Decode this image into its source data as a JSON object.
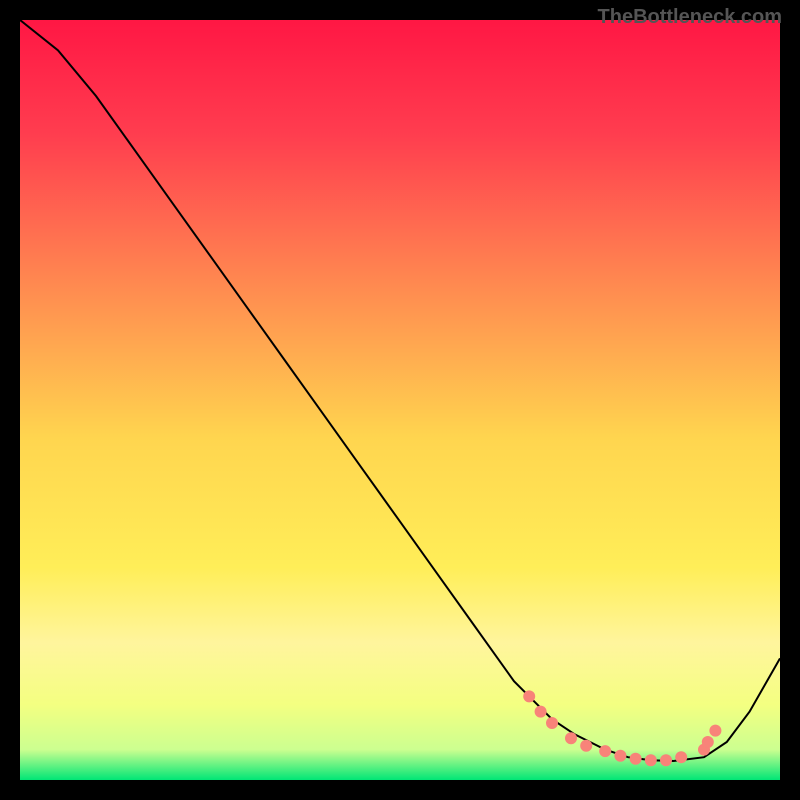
{
  "watermark": "TheBottleneck.com",
  "chart_data": {
    "type": "line",
    "title": "",
    "xlabel": "",
    "ylabel": "",
    "xlim": [
      0,
      100
    ],
    "ylim": [
      0,
      100
    ],
    "background_gradient": {
      "type": "vertical",
      "stops": [
        {
          "pos": 0.0,
          "color": "#ff1744"
        },
        {
          "pos": 0.15,
          "color": "#ff3d4f"
        },
        {
          "pos": 0.35,
          "color": "#ff8a50"
        },
        {
          "pos": 0.55,
          "color": "#ffd54f"
        },
        {
          "pos": 0.72,
          "color": "#ffee58"
        },
        {
          "pos": 0.82,
          "color": "#fff59d"
        },
        {
          "pos": 0.9,
          "color": "#f4ff81"
        },
        {
          "pos": 0.96,
          "color": "#ccff90"
        },
        {
          "pos": 1.0,
          "color": "#00e676"
        }
      ]
    },
    "series": [
      {
        "name": "main-curve",
        "color": "#000000",
        "stroke_width": 2,
        "x": [
          0,
          5,
          10,
          15,
          20,
          25,
          30,
          35,
          40,
          45,
          50,
          55,
          60,
          65,
          67,
          70,
          73,
          77,
          80,
          83,
          86,
          90,
          93,
          96,
          100
        ],
        "values": [
          100,
          96,
          90,
          83,
          76,
          69,
          62,
          55,
          48,
          41,
          34,
          27,
          20,
          13,
          11,
          8,
          6,
          4,
          3,
          2.6,
          2.5,
          3,
          5,
          9,
          16
        ]
      }
    ],
    "markers": {
      "name": "bottom-dots",
      "color": "#f88379",
      "radius": 6,
      "points": [
        {
          "x": 67,
          "y": 11
        },
        {
          "x": 68.5,
          "y": 9
        },
        {
          "x": 70,
          "y": 7.5
        },
        {
          "x": 72.5,
          "y": 5.5
        },
        {
          "x": 74.5,
          "y": 4.5
        },
        {
          "x": 77,
          "y": 3.8
        },
        {
          "x": 79,
          "y": 3.2
        },
        {
          "x": 81,
          "y": 2.8
        },
        {
          "x": 83,
          "y": 2.6
        },
        {
          "x": 85,
          "y": 2.6
        },
        {
          "x": 87,
          "y": 3.0
        },
        {
          "x": 90,
          "y": 4.0
        },
        {
          "x": 90.5,
          "y": 5.0
        },
        {
          "x": 91.5,
          "y": 6.5
        }
      ]
    }
  }
}
